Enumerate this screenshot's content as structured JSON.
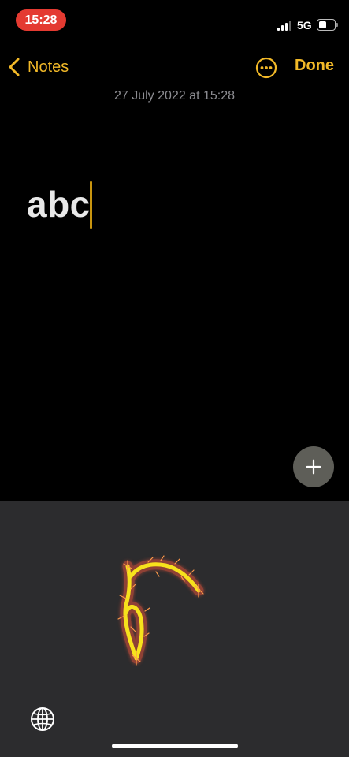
{
  "status_bar": {
    "time": "15:28",
    "network": "5G",
    "battery_level": 0.55,
    "signal_bars_active": 3,
    "signal_bars_total": 4
  },
  "nav": {
    "back_label": "Notes",
    "done_label": "Done",
    "more_icon": "ellipsis-circle-icon"
  },
  "note": {
    "date": "27 July 2022 at 15:28",
    "text": "abc"
  },
  "add_button_icon": "plus-icon",
  "keyboard": {
    "mode": "handwriting",
    "globe_icon": "globe-icon"
  },
  "colors": {
    "accent": "#f2b928",
    "background": "#000000",
    "keyboard_bg": "#2c2c2e",
    "stroke": "#f7e21c",
    "stroke_glow": "#e0533a",
    "time_pill": "#e43a31"
  }
}
